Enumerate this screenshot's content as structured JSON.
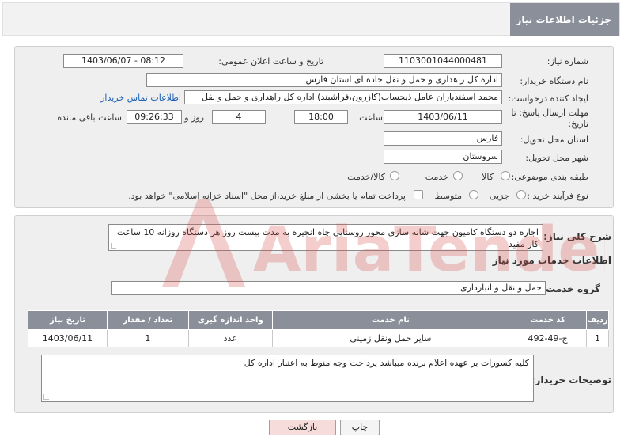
{
  "header": {
    "title": "جزئیات اطلاعات نیاز"
  },
  "form": {
    "need_number_label": "شماره نیاز:",
    "need_number": "1103001044000481",
    "announce_label": "تاریخ و ساعت اعلان عمومی:",
    "announce_value": "1403/06/07 - 08:12",
    "buyer_org_label": "نام دستگاه خریدار:",
    "buyer_org": "اداره کل راهداری و حمل و نقل جاده ای استان فارس",
    "creator_label": "ایجاد کننده درخواست:",
    "creator": "محمد اسفندیاران عامل ذیحساب(کازرون،فراشبند) اداره کل راهداری و حمل و نقل",
    "contact_link": "اطلاعات تماس خریدار",
    "deadline_label": "مهلت ارسال پاسخ: تا تاریخ:",
    "deadline_date": "1403/06/11",
    "time_label": "ساعت",
    "deadline_time": "18:00",
    "days_value": "4",
    "days_label": "روز و",
    "remaining_time": "09:26:33",
    "remaining_label": "ساعت باقی مانده",
    "province_label": "استان محل تحویل:",
    "province": "فارس",
    "city_label": "شهر محل تحویل:",
    "city": "سروستان",
    "category_label": "طبقه بندی موضوعی:",
    "category_options": [
      "کالا",
      "خدمت",
      "کالا/خدمت"
    ],
    "process_label": "نوع فرآیند خرید :",
    "process_options": [
      "جزیی",
      "متوسط"
    ],
    "payment_note": "پرداخت تمام یا بخشی از مبلغ خرید،از محل \"اسناد خزانه اسلامی\" خواهد بود."
  },
  "details": {
    "summary_label": "شرح کلی نیاز:",
    "summary": "اجاره دو دستگاه کامیون جهت شانه سازی محور روستایی چاه انجیره به مدت بیست روز هر دستگاه روزانه 10 ساعت کار مفید",
    "services_title": "اطلاعات خدمات مورد نیاز",
    "service_group_label": "گروه خدمت:",
    "service_group": "حمل و نقل و انبارداری",
    "table": {
      "headers": [
        "ردیف",
        "کد خدمت",
        "نام خدمت",
        "واحد اندازه گیری",
        "تعداد / مقدار",
        "تاریخ نیاز"
      ],
      "rows": [
        [
          "1",
          "ج-49-492",
          "سایر حمل ونقل زمینی",
          "عدد",
          "1",
          "1403/06/11"
        ]
      ]
    },
    "buyer_notes_label": "توضیحات خریدار:",
    "buyer_notes": "کلیه کسورات بر عهده اعلام برنده میباشد پرداخت وجه منوط به اعتبار اداره کل"
  },
  "buttons": {
    "print": "چاپ",
    "back": "بازگشت"
  },
  "watermark": {
    "text": "AriaTender.neT"
  },
  "colors": {
    "header_bg": "#8a8f99",
    "link": "#1a5fb4",
    "back_button": "#f7dcdc",
    "watermark": "#d9534f"
  }
}
